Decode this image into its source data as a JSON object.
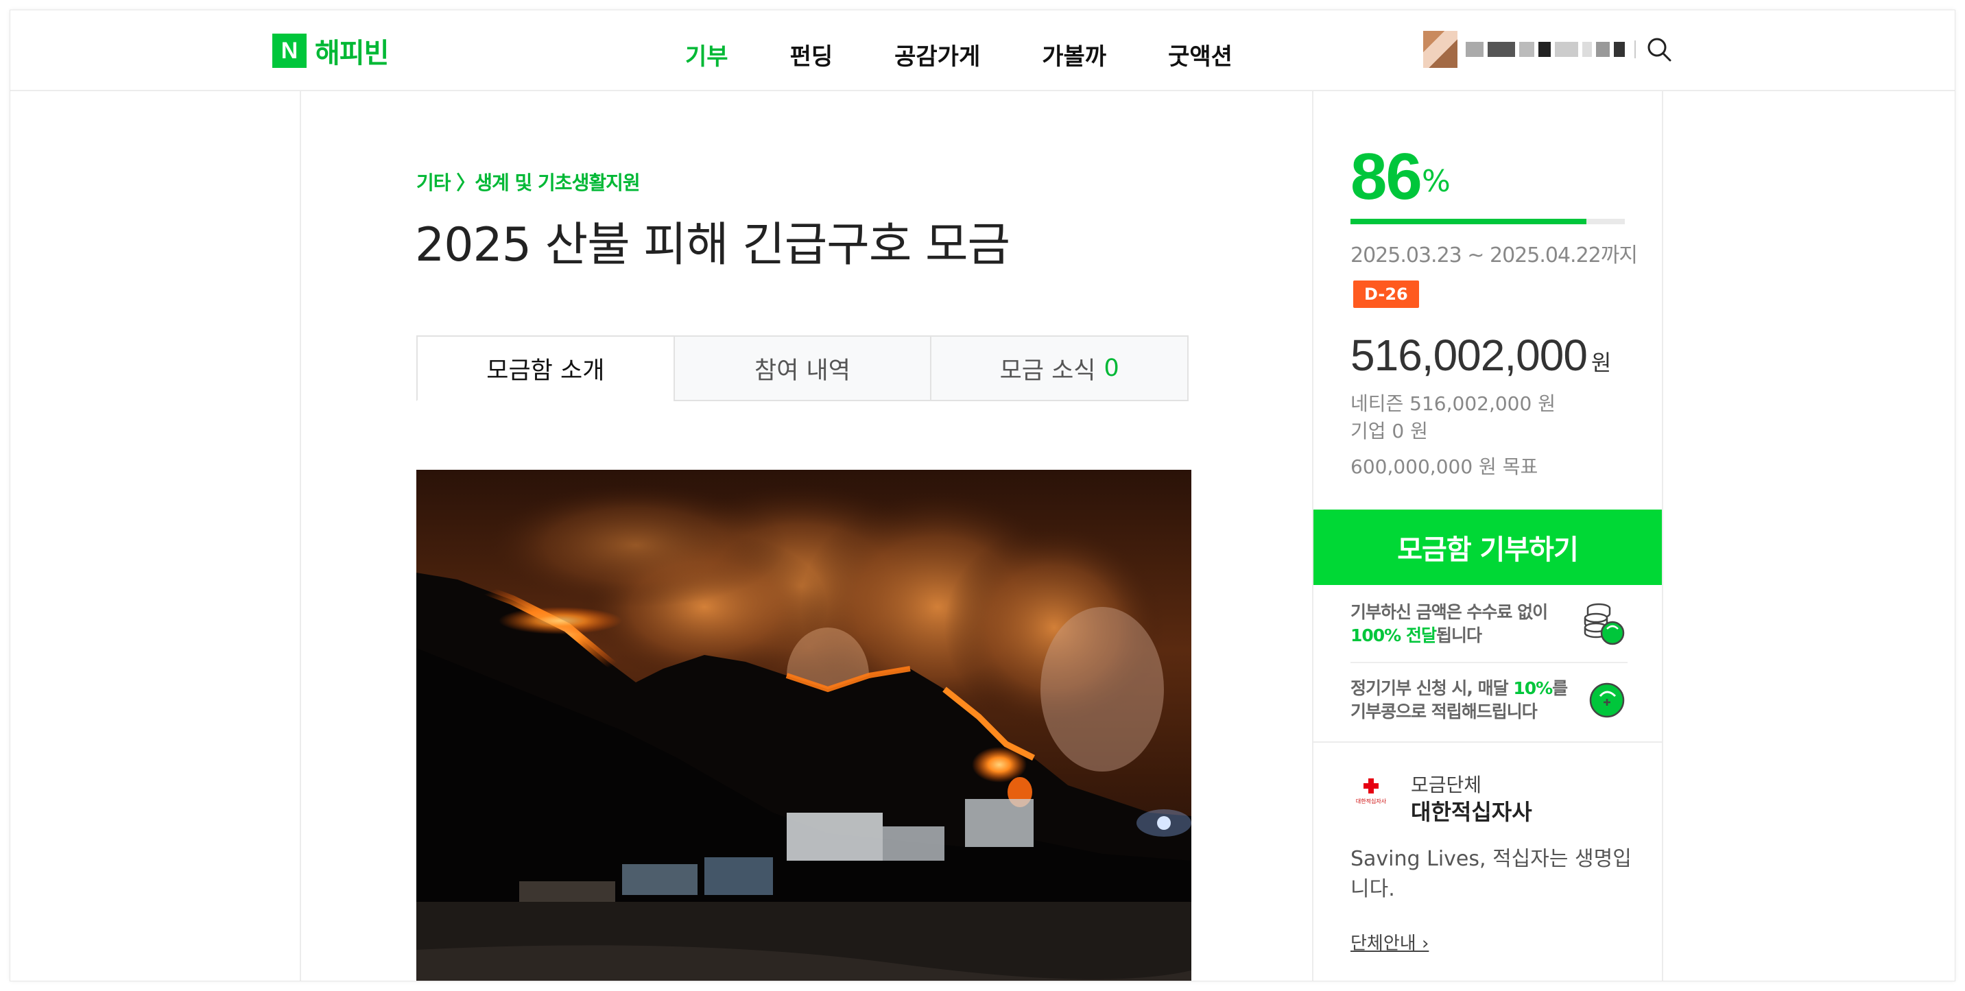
{
  "header": {
    "logo_mark": "N",
    "logo_text": "해피빈",
    "nav": [
      "기부",
      "펀딩",
      "공감가게",
      "가볼까",
      "굿액션"
    ],
    "active_nav": "기부",
    "profile_name_redacted": true
  },
  "campaign": {
    "breadcrumb": "기타 〉생계 및 기초생활지원",
    "title": "2025 산불 피해 긴급구호 모금",
    "tabs": [
      {
        "label": "모금함 소개",
        "active": true
      },
      {
        "label": "참여 내역",
        "active": false
      },
      {
        "label": "모금 소식",
        "count": "0",
        "active": false
      }
    ],
    "photo_alt": "산불"
  },
  "summary": {
    "percent": "86",
    "percent_unit": "%",
    "progress_fraction": 0.86,
    "period": "2025.03.23 ~ 2025.04.22까지",
    "dday": "D-26",
    "amount": "516,002,000",
    "amount_unit": "원",
    "netizen": "네티즌 516,002,000 원",
    "company": "기업 0 원",
    "goal": "600,000,000 원 목표",
    "donate_button": "모금함 기부하기",
    "info1_a": "기부하신 금액은 수수료 없이",
    "info1_b_green": "100% 전달",
    "info1_b_rest": "됩니다",
    "info2_a_1": "정기기부 신청 시, 매달 ",
    "info2_a_green": "10%",
    "info2_a_2": "를",
    "info2_b": "기부콩으로 적립해드립니다"
  },
  "organization": {
    "label": "모금단체",
    "name": "대한적십자사",
    "logo_caption": "대한적십자사",
    "description": "Saving Lives, 적십자는 생명입니다.",
    "link": "단체안내 ›"
  },
  "colors": {
    "brand_green": "#00c63b",
    "button_green": "#00d835",
    "dday_orange": "#ff5a1f",
    "cross_red": "#e60012"
  },
  "icons": [
    "search-icon",
    "coins-icon",
    "bean-icon",
    "red-cross-icon"
  ]
}
